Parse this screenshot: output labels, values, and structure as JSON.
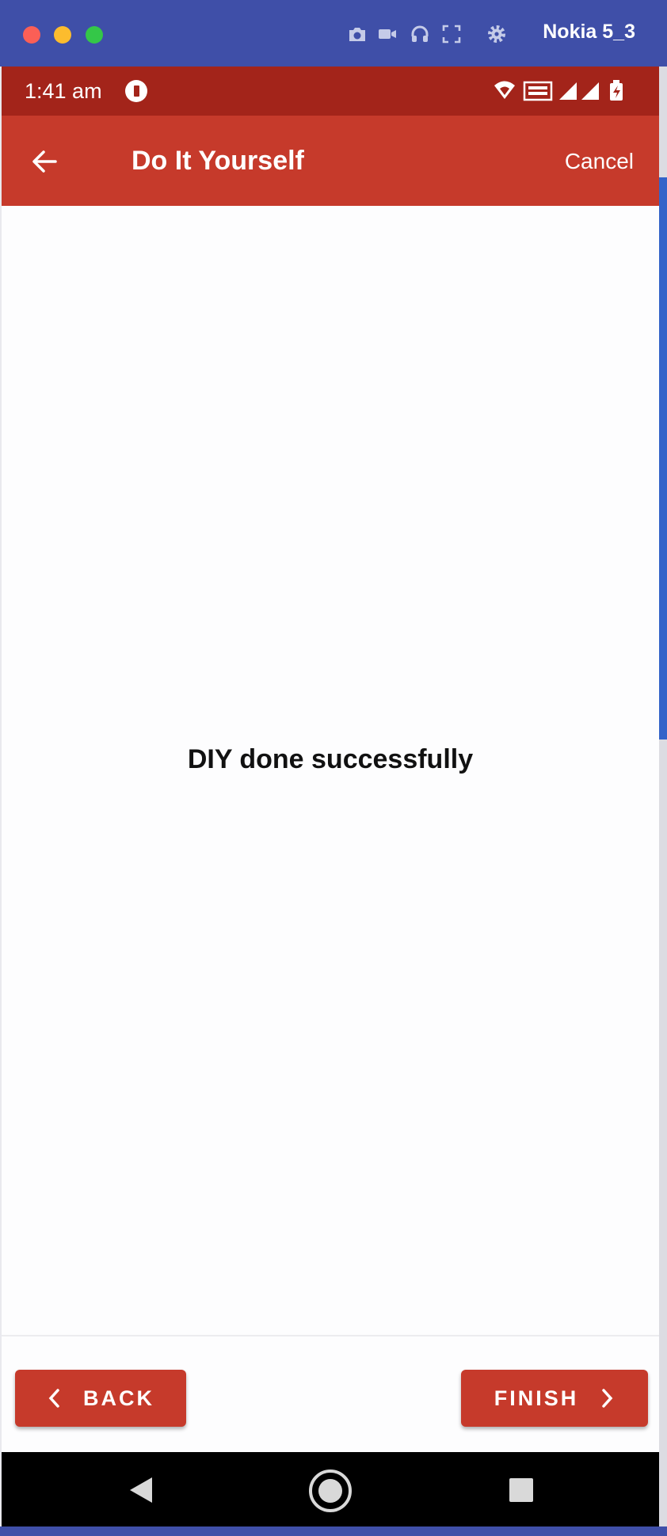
{
  "window": {
    "device_name": "Nokia 5_3",
    "toolbar_icons": [
      "camera-icon",
      "video-icon",
      "headphones-icon",
      "fullscreen-icon",
      "gear-icon"
    ]
  },
  "status_bar": {
    "time": "1:41 am",
    "icons": [
      "app-notification-icon",
      "wifi-icon",
      "volte-icon",
      "signal-icon",
      "signal-icon",
      "battery-icon"
    ]
  },
  "app_bar": {
    "title": "Do It Yourself",
    "cancel_label": "Cancel"
  },
  "content": {
    "message": "DIY done successfully"
  },
  "footer": {
    "back_label": "BACK",
    "finish_label": "FINISH"
  },
  "colors": {
    "window_bar": "#3f4fa8",
    "status_bar": "#a3241a",
    "app_bar": "#c63a2b",
    "button": "#c63a2b"
  }
}
